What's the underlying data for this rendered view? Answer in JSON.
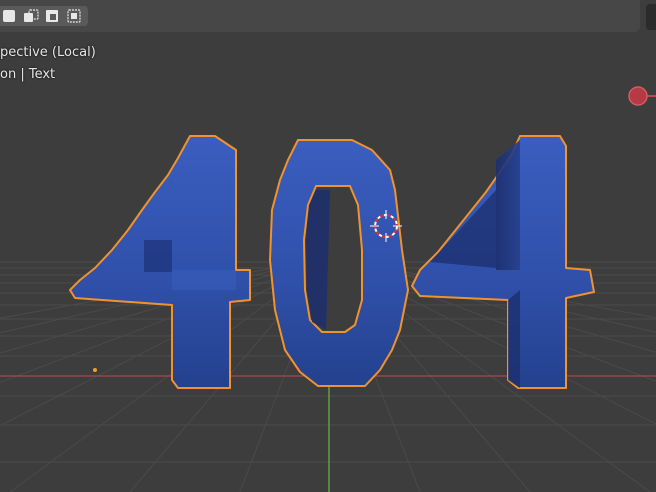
{
  "viewport": {
    "view_name": "pective (Local)",
    "object_info": "on | Text"
  },
  "scene": {
    "text_object": "404"
  },
  "colors": {
    "background": "#3d3d3d",
    "grid_line": "#4a4a4a",
    "x_axis": "#c4464e",
    "y_axis": "#63a83a",
    "object_fill": "#2f4fa8",
    "selection_outline": "#f0922e"
  },
  "icons": {
    "select_new": "select-new-icon",
    "select_extend": "select-extend-icon",
    "select_subtract": "select-subtract-icon",
    "select_intersect": "select-intersect-icon",
    "cursor_3d": "3d-cursor-icon",
    "gizmo_x": "gizmo-x-axis-icon"
  }
}
